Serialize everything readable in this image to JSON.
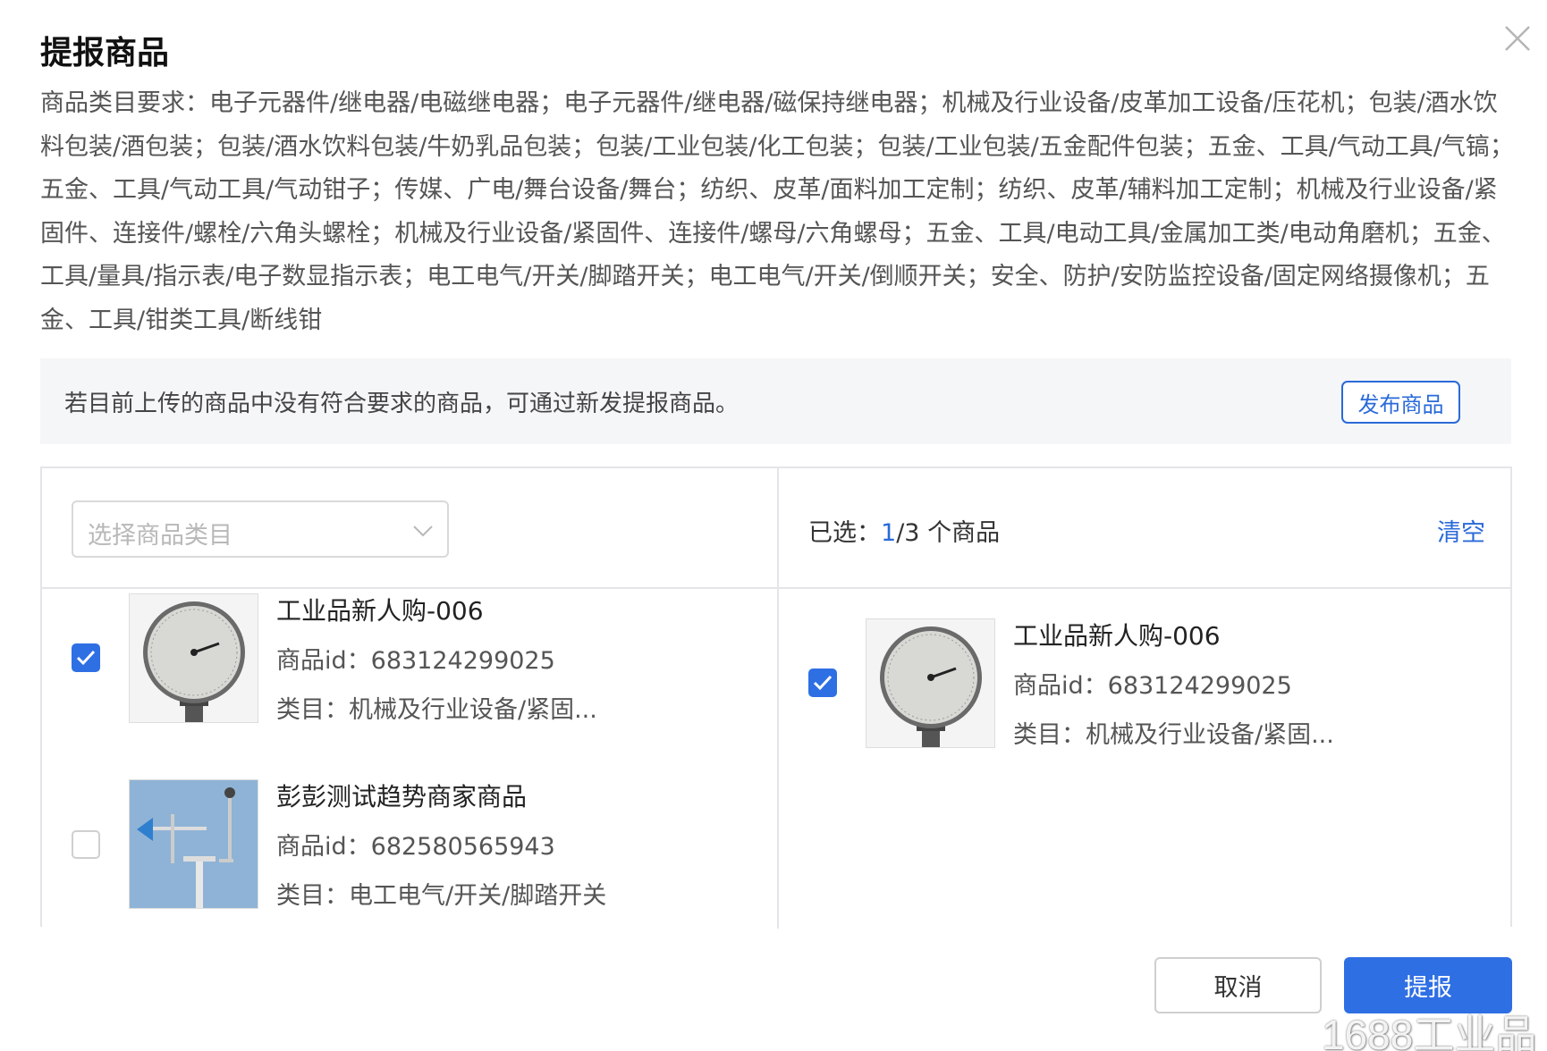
{
  "dialog": {
    "title": "提报商品",
    "close_icon": "close-icon"
  },
  "requirements": {
    "text": "商品类目要求：电子元器件/继电器/电磁继电器；电子元器件/继电器/磁保持继电器；机械及行业设备/皮革加工设备/压花机；包装/酒水饮料包装/酒包装；包装/酒水饮料包装/牛奶乳品包装；包装/工业包装/化工包装；包装/工业包装/五金配件包装；五金、工具/气动工具/气镐；五金、工具/气动工具/气动钳子；传媒、广电/舞台设备/舞台；纺织、皮革/面料加工定制；纺织、皮革/辅料加工定制；机械及行业设备/紧固件、连接件/螺栓/六角头螺栓；机械及行业设备/紧固件、连接件/螺母/六角螺母；五金、工具/电动工具/金属加工类/电动角磨机；五金、工具/量具/指示表/电子数显指示表；电工电气/开关/脚踏开关；电工电气/开关/倒顺开关；安全、防护/安防监控设备/固定网络摄像机；五金、工具/钳类工具/断线钳"
  },
  "notice": {
    "text": "若目前上传的商品中没有符合要求的商品，可通过新发提报商品。",
    "publish_label": "发布商品"
  },
  "left_panel": {
    "select_placeholder": "选择商品类目",
    "items": [
      {
        "name": "工业品新人购-006",
        "id_label": "商品id：",
        "id": "683124299025",
        "cat_label": "类目：",
        "category": "机械及行业设备/紧固...",
        "checked": true,
        "image": "pressure-gauge"
      },
      {
        "name": "彭彭测试趋势商家商品",
        "id_label": "商品id：",
        "id": "682580565943",
        "cat_label": "类目：",
        "category": "电工电气/开关/脚踏开关",
        "checked": false,
        "image": "weather-vane"
      }
    ]
  },
  "right_panel": {
    "selected_prefix": "已选：",
    "selected_count": "1",
    "selected_sep": "/",
    "selected_max": "3",
    "selected_suffix": " 个商品",
    "clear_label": "清空",
    "items": [
      {
        "name": "工业品新人购-006",
        "id_label": "商品id：",
        "id": "683124299025",
        "cat_label": "类目：",
        "category": "机械及行业设备/紧固...",
        "checked": true,
        "image": "pressure-gauge"
      }
    ]
  },
  "footer": {
    "cancel_label": "取消",
    "submit_label": "提报"
  },
  "watermark": "1688工业品",
  "colors": {
    "accent": "#2f6fe4",
    "link": "#2a6ad9",
    "border": "#e3e5e8",
    "notice_bg": "#f5f6f8"
  }
}
